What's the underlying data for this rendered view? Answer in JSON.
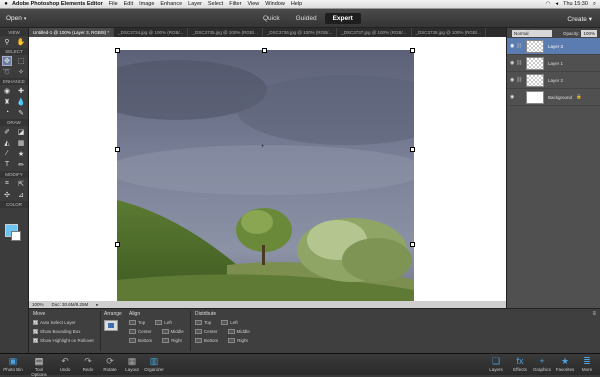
{
  "menubar": {
    "apple": "",
    "app_name": "Adobe Photoshop Elements Editor",
    "items": [
      "File",
      "Edit",
      "Image",
      "Enhance",
      "Layer",
      "Select",
      "Filter",
      "View",
      "Window",
      "Help"
    ],
    "clock": "Thu 15:30"
  },
  "header": {
    "open_label": "Open",
    "modes": [
      {
        "label": "Quick",
        "active": false
      },
      {
        "label": "Guided",
        "active": false
      },
      {
        "label": "Expert",
        "active": true
      }
    ],
    "create_label": "Create"
  },
  "tools": {
    "groups": [
      "VIEW",
      "SELECT",
      "ENHANCE",
      "DRAW",
      "MODIFY",
      "COLOR"
    ]
  },
  "tabs": [
    "Untitled-1 @ 100% (Layer 3, RGB/8) *",
    "_DSC3734.jpg @ 100% (RGB/...",
    "_DSC3735.jpg @ 100% (RGB/...",
    "_DSC3736.jpg @ 100% (RGB/...",
    "_DSC3737.jpg @ 100% (RGB/...",
    "_DSC3738.jpg @ 100% (RGB/..."
  ],
  "status": {
    "zoom": "100%",
    "doc": "Doc: 30.6M/8.25M"
  },
  "layers_panel": {
    "blend_mode": "Normal",
    "opacity_label": "Opacity:",
    "opacity_value": "100%",
    "layers": [
      {
        "name": "Layer 3",
        "active": true
      },
      {
        "name": "Layer 1",
        "active": false
      },
      {
        "name": "Layer 2",
        "active": false
      },
      {
        "name": "Background",
        "active": false
      }
    ]
  },
  "tool_options": {
    "move_title": "Move",
    "checks": [
      {
        "label": "Auto Select Layer",
        "checked": true
      },
      {
        "label": "Show Bounding Box",
        "checked": true
      },
      {
        "label": "Show Highlight on Rollover",
        "checked": true
      }
    ],
    "arrange_title": "Arrange",
    "align_title": "Align",
    "align_rows": [
      [
        "Top",
        "Left"
      ],
      [
        "Center",
        "Middle"
      ],
      [
        "Bottom",
        "Right"
      ]
    ],
    "distribute_title": "Distribute",
    "distribute_rows": [
      [
        "Top",
        "Left"
      ],
      [
        "Center",
        "Middle"
      ],
      [
        "Bottom",
        "Right"
      ]
    ]
  },
  "taskbar": {
    "left": [
      "Photo Bin",
      "Tool Options",
      "Undo",
      "Redo",
      "Rotate",
      "Layout",
      "Organizer"
    ],
    "right": [
      "Layers",
      "Effects",
      "Graphics",
      "Favorites",
      "More"
    ]
  }
}
